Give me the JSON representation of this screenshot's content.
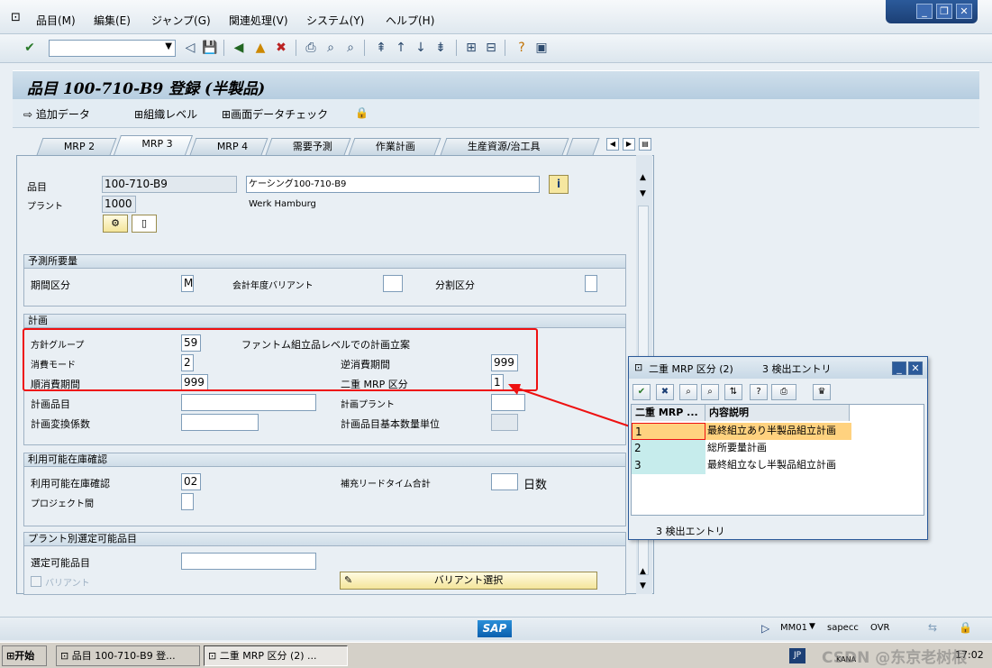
{
  "menu": [
    "品目(M)",
    "編集(E)",
    "ジャンプ(G)",
    "関連処理(V)",
    "システム(Y)",
    "ヘルプ(H)"
  ],
  "title": "品目 100-710-B9 登録 (半製品)",
  "app_toolbar": {
    "add_data": "追加データ",
    "org_level": "組織レベル",
    "screen_check": "画面データチェック"
  },
  "tabs": [
    "MRP 2",
    "MRP 3",
    "MRP 4",
    "需要予測",
    "作業計画",
    "生産資源/治工具"
  ],
  "header": {
    "material_label": "品目",
    "material_value": "100-710-B9",
    "material_desc": "ケーシング100-710-B9",
    "plant_label": "プラント",
    "plant_value": "1000",
    "plant_name": "Werk Hamburg"
  },
  "forecast": {
    "title": "予測所要量",
    "period_label": "期間区分",
    "period_value": "M",
    "fy_variant_label": "会計年度バリアント",
    "fy_variant_value": "",
    "split_label": "分割区分",
    "split_value": ""
  },
  "planning": {
    "title": "計画",
    "strategy_label": "方針グループ",
    "strategy_value": "59",
    "strategy_desc": "ファントム組立品レベルでの計画立案",
    "consumption_label": "消費モード",
    "consumption_value": "2",
    "back_label": "逆消費期間",
    "back_value": "999",
    "fwd_label": "順消費期間",
    "fwd_value": "999",
    "mixed_label": "二重 MRP 区分",
    "mixed_value": "1",
    "plan_mat_label": "計画品目",
    "plan_mat_value": "",
    "plan_plant_label": "計画プラント",
    "plan_plant_value": "",
    "conv_label": "計画変換係数",
    "conv_value": "",
    "base_uom_label": "計画品目基本数量単位",
    "base_uom_value": ""
  },
  "availability": {
    "title": "利用可能在庫確認",
    "check_label": "利用可能在庫確認",
    "check_value": "02",
    "rlt_label": "補充リードタイム合計",
    "rlt_value": "",
    "rlt_unit": "日数",
    "cross_label": "プロジェクト間",
    "cross_value": ""
  },
  "plant_sel": {
    "title": "プラント別選定可能品目",
    "sel_label": "選定可能品目",
    "sel_value": "",
    "variant_label": "バリアント",
    "variant_button": "バリアント選択"
  },
  "popup": {
    "title": "二重 MRP 区分 (2)",
    "hits_title": "3 検出エントリ",
    "col1": "二重 MRP ...",
    "col2": "内容説明",
    "rows": [
      {
        "key": "1",
        "text": "最終組立あり半製品組立計画"
      },
      {
        "key": "2",
        "text": "総所要量計画"
      },
      {
        "key": "3",
        "text": "最終組立なし半製品組立計画"
      }
    ],
    "footer": "3 検出エントリ"
  },
  "status": {
    "tcode": "MM01",
    "server": "sapecc",
    "mode": "OVR",
    "logo": "SAP"
  },
  "taskbar": {
    "start": "开始",
    "task1": "品目 100-710-B9 登...",
    "task2": "二重 MRP 区分 (2) ...",
    "ime": "JP",
    "kana": "KANA",
    "time": "17:02",
    "watermark": "CSDN @东京老树根"
  },
  "colors": {
    "accent": "#2b5a9a",
    "highlight": "#ffd27f",
    "red": "#e11"
  }
}
